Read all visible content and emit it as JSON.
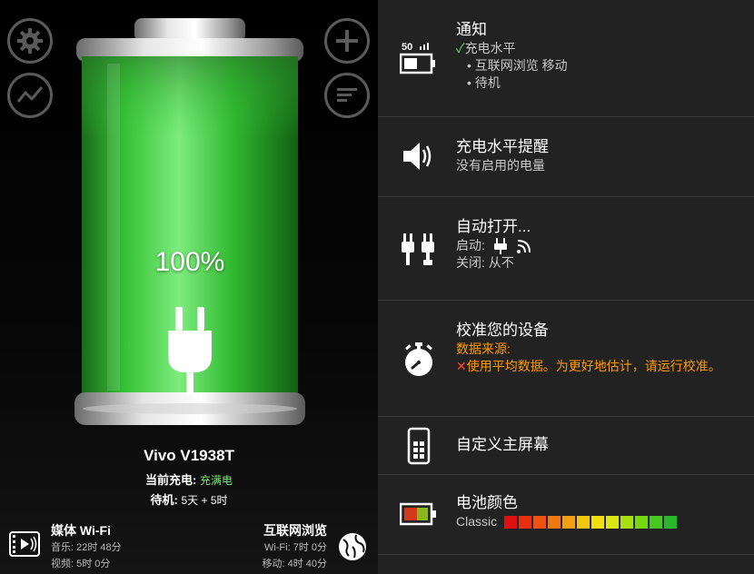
{
  "left": {
    "battery_percent_text": "100%",
    "battery_level": 1.0,
    "device_name": "Vivo V1938T",
    "charge_label": "当前充电:",
    "charge_value": "充满电",
    "standby_label": "待机:",
    "standby_value": "5天 + 5时",
    "media": {
      "title": "媒体 Wi-Fi",
      "music": "音乐: 22时 48分",
      "video": "视频: 5时 0分"
    },
    "internet": {
      "title": "互联网浏览",
      "wifi": "Wi-Fi: 7时 0分",
      "mobile": "移动: 4时 40分"
    },
    "icons": [
      "gear-icon",
      "chart-icon",
      "plus-icon",
      "list-icon",
      "plug-icon",
      "media-icon",
      "globe-icon"
    ]
  },
  "right": {
    "notification": {
      "badge": "50",
      "title": "通知",
      "check": "✓",
      "line1": "充电水平",
      "line2": "• 互联网浏览 移动",
      "line3": "• 待机"
    },
    "level_alert": {
      "title": "充电水平提醒",
      "sub": "没有启用的电量"
    },
    "auto_on": {
      "title": "自动打开...",
      "start_label": "启动:",
      "close_label": "关闭: 从不"
    },
    "calibrate": {
      "title": "校准您的设备",
      "source_label": "数据来源:",
      "cross": "✕",
      "message": "使用平均数据。为更好地估计，请运行校准。"
    },
    "home_screen": {
      "title": "自定义主屏幕"
    },
    "battery_color": {
      "title": "电池颜色",
      "theme": "Classic",
      "swatches": [
        "#e01010",
        "#e83010",
        "#f05010",
        "#f07810",
        "#f0a010",
        "#f0c810",
        "#f0e010",
        "#d8e810",
        "#a8e010",
        "#78d810",
        "#48c820",
        "#28b828"
      ]
    }
  },
  "colors": {
    "accent_green": "#3ccc3c",
    "warning_orange": "#ff9a00",
    "panel_bg": "#222222"
  }
}
